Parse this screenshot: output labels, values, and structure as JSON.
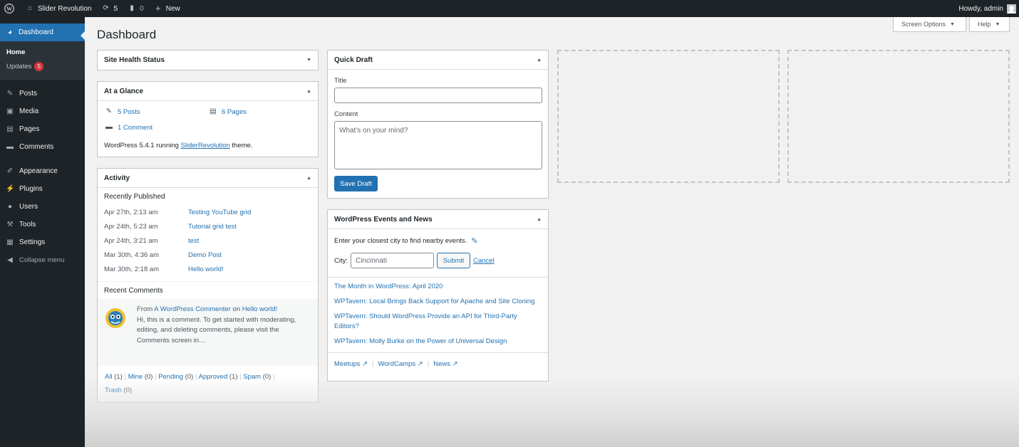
{
  "admin_bar": {
    "site_name": "Slider Revolution",
    "updates_count": "5",
    "comments_count": "0",
    "new_label": "New",
    "greeting": "Howdy, admin"
  },
  "sidebar": {
    "dashboard": "Dashboard",
    "submenu": [
      {
        "label": "Home"
      },
      {
        "label": "Updates",
        "badge": "5"
      }
    ],
    "items": [
      {
        "label": "Posts",
        "icon": "pin-icon"
      },
      {
        "label": "Media",
        "icon": "media-icon"
      },
      {
        "label": "Pages",
        "icon": "pages-icon"
      },
      {
        "label": "Comments",
        "icon": "comment-icon"
      },
      {
        "label": "Appearance",
        "icon": "brush-icon"
      },
      {
        "label": "Plugins",
        "icon": "plug-icon"
      },
      {
        "label": "Users",
        "icon": "user-icon"
      },
      {
        "label": "Tools",
        "icon": "wrench-icon"
      },
      {
        "label": "Settings",
        "icon": "settings-icon"
      }
    ],
    "collapse": "Collapse menu"
  },
  "page_title": "Dashboard",
  "screen_options": "Screen Options",
  "help": "Help",
  "site_health": {
    "title": "Site Health Status"
  },
  "glance": {
    "title": "At a Glance",
    "posts": "5 Posts",
    "pages": "6 Pages",
    "comments": "1 Comment",
    "version_text_pre": "WordPress 5.4.1 running",
    "theme": "SliderRevolution",
    "version_text_post": "theme."
  },
  "activity": {
    "title": "Activity",
    "recently_published": "Recently Published",
    "posts": [
      {
        "date": "Apr 27th, 2:13 am",
        "title": "Testing YouTube grid"
      },
      {
        "date": "Apr 24th, 5:23 am",
        "title": "Tutorial grid test"
      },
      {
        "date": "Apr 24th, 3:21 am",
        "title": "test"
      },
      {
        "date": "Mar 30th, 4:36 am",
        "title": "Demo Post"
      },
      {
        "date": "Mar 30th, 2:18 am",
        "title": "Hello world!"
      }
    ],
    "recent_comments": "Recent Comments",
    "comment": {
      "from": "From",
      "author": "A WordPress Commenter",
      "on": "on",
      "post": "Hello world!",
      "text": "Hi, this is a comment. To get started with moderating, editing, and deleting comments, please visit the Comments screen in…"
    },
    "filters": [
      {
        "label": "All",
        "count": "(1)"
      },
      {
        "label": "Mine",
        "count": "(0)"
      },
      {
        "label": "Pending",
        "count": "(0)"
      },
      {
        "label": "Approved",
        "count": "(1)"
      },
      {
        "label": "Spam",
        "count": "(0)"
      },
      {
        "label": "Trash",
        "count": "(0)"
      }
    ]
  },
  "quick_draft": {
    "title": "Quick Draft",
    "title_label": "Title",
    "content_label": "Content",
    "content_placeholder": "What's on your mind?",
    "save": "Save Draft"
  },
  "events": {
    "title": "WordPress Events and News",
    "intro": "Enter your closest city to find nearby events.",
    "city_label": "City:",
    "city_value": "Cincinnati",
    "submit": "Submit",
    "cancel": "Cancel",
    "news": [
      "The Month in WordPress: April 2020",
      "WPTavern: Local Brings Back Support for Apache and Site Cloning",
      "WPTavern: Should WordPress Provide an API for Third-Party Editors?",
      "WPTavern: Molly Burke on the Power of Universal Design"
    ],
    "footer": [
      "Meetups",
      "WordCamps",
      "News"
    ]
  }
}
